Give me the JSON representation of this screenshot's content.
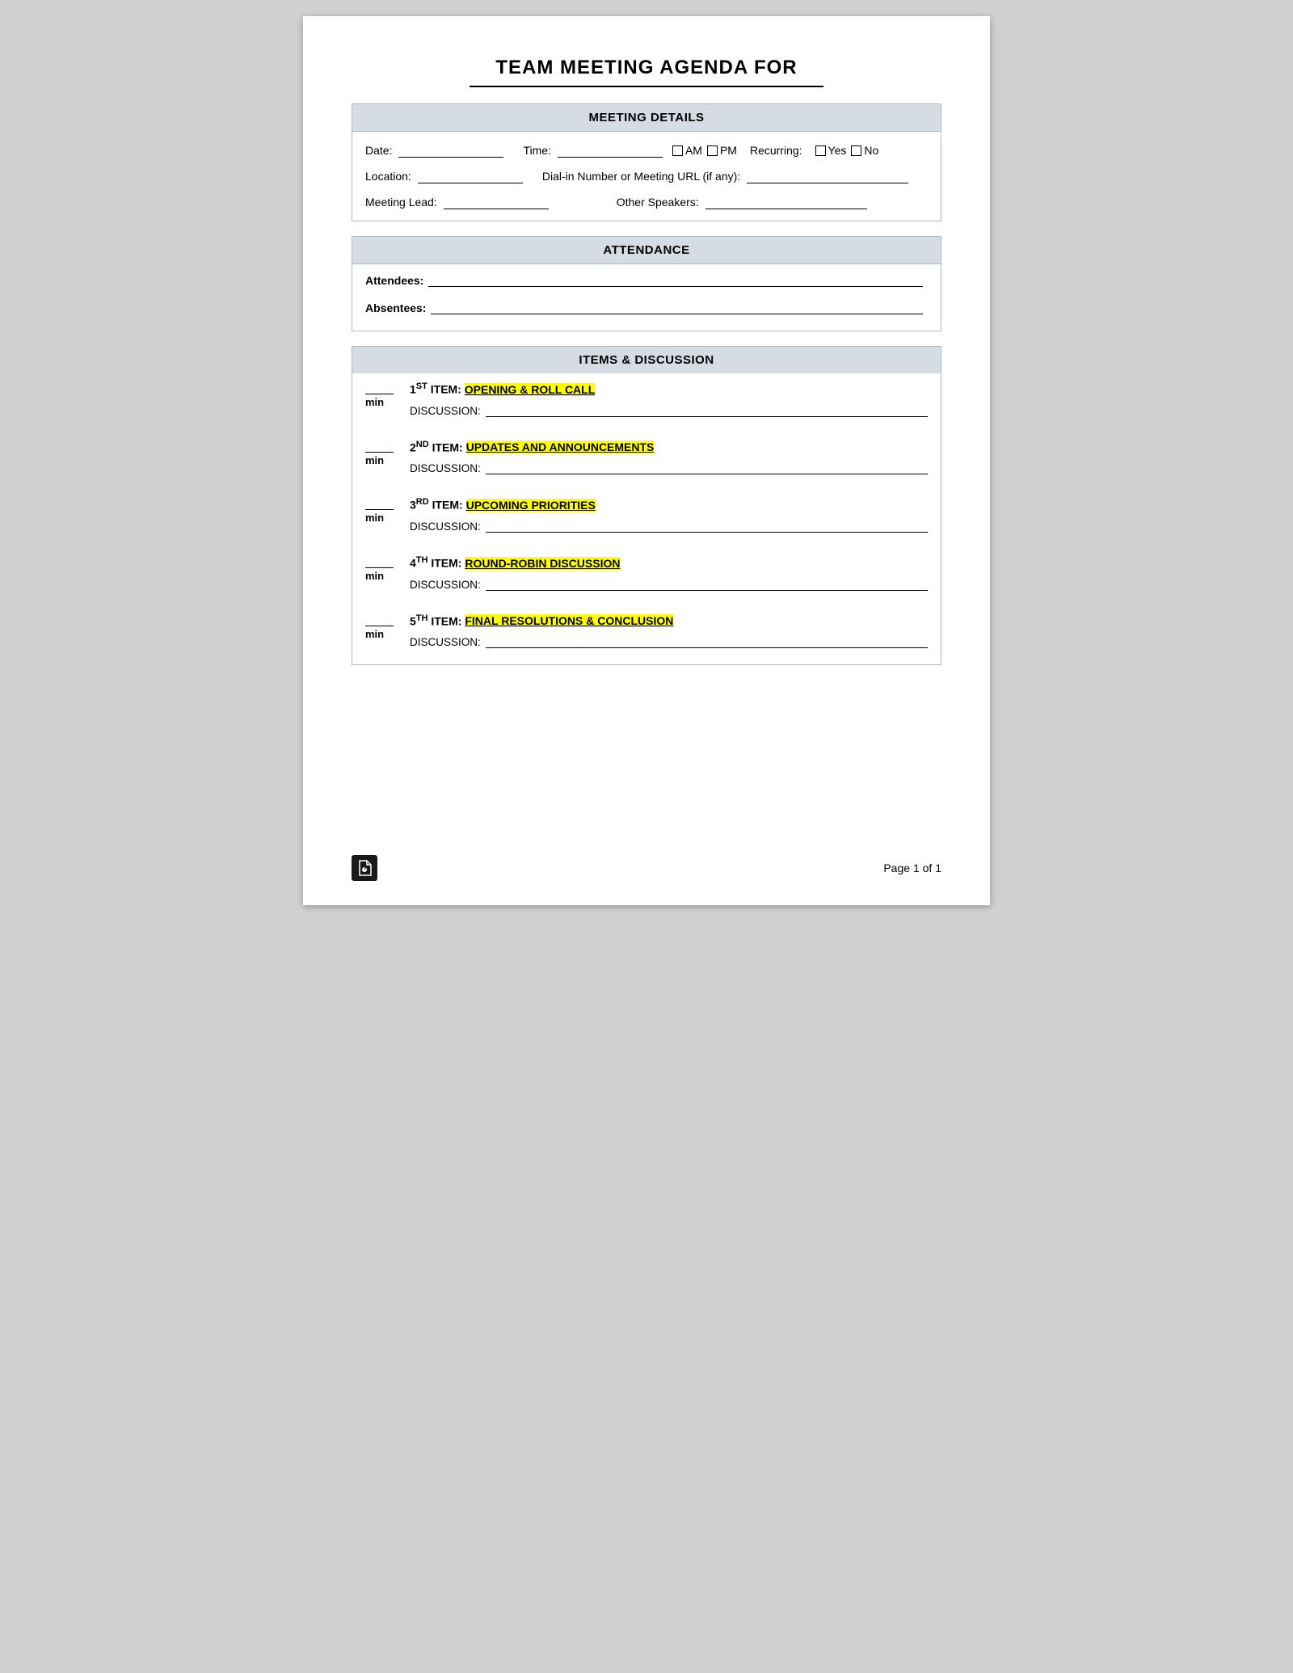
{
  "title": {
    "main": "TEAM MEETING AGENDA FOR",
    "underline": ""
  },
  "meeting_details": {
    "header": "MEETING DETAILS",
    "date_label": "Date:",
    "time_label": "Time:",
    "am_label": "AM",
    "pm_label": "PM",
    "recurring_label": "Recurring:",
    "yes_label": "Yes",
    "no_label": "No",
    "location_label": "Location:",
    "dialin_label": "Dial-in Number or Meeting URL (if any):",
    "meeting_lead_label": "Meeting Lead:",
    "other_speakers_label": "Other Speakers:"
  },
  "attendance": {
    "header": "ATTENDANCE",
    "attendees_label": "Attendees:",
    "absentees_label": "Absentees:"
  },
  "items": {
    "header": "ITEMS & DISCUSSION",
    "discussion_label": "DISCUSSION:",
    "agenda_items": [
      {
        "number": "1",
        "ordinal": "ST",
        "title": "OPENING & ROLL CALL"
      },
      {
        "number": "2",
        "ordinal": "ND",
        "title": "UPDATES AND ANNOUNCEMENTS"
      },
      {
        "number": "3",
        "ordinal": "RD",
        "title": "UPCOMING PRIORITIES"
      },
      {
        "number": "4",
        "ordinal": "TH",
        "title": "ROUND-ROBIN DISCUSSION"
      },
      {
        "number": "5",
        "ordinal": "TH",
        "title": "FINAL RESOLUTIONS & CONCLUSION"
      }
    ],
    "min_label": "min"
  },
  "footer": {
    "page_label": "Page",
    "page_number": "1",
    "of_label": "of",
    "total_pages": "1"
  }
}
